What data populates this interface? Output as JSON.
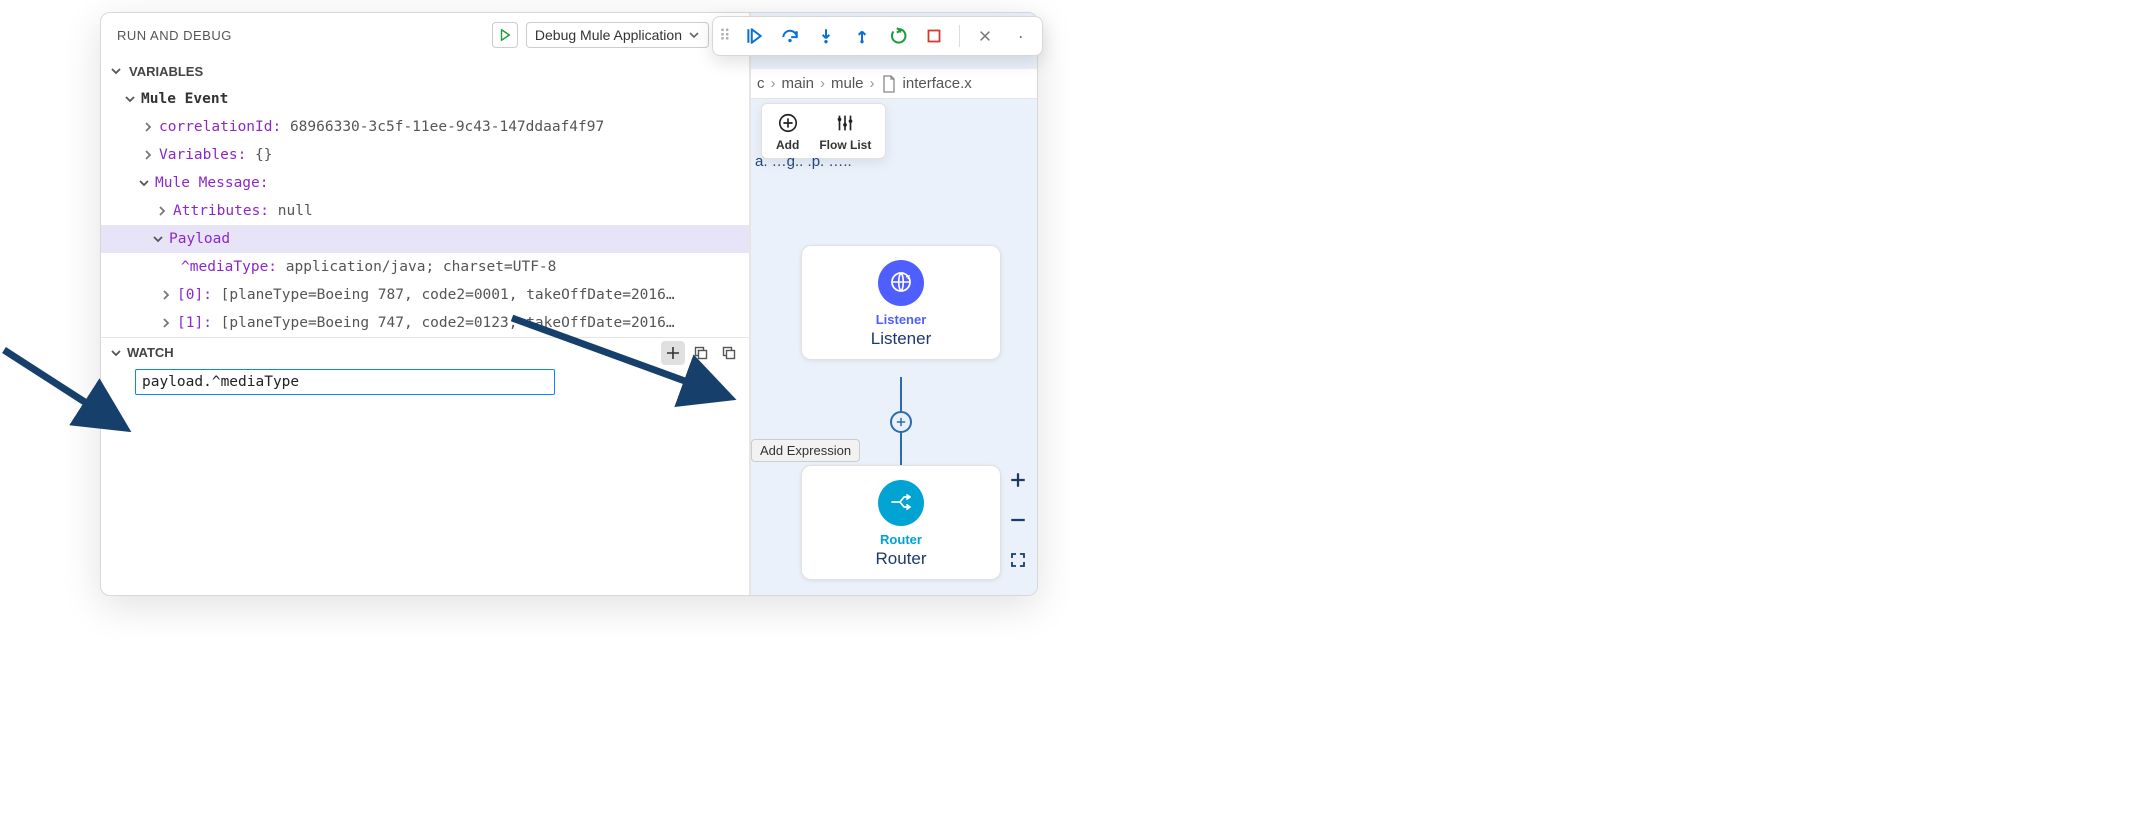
{
  "runDebug": {
    "title": "RUN AND DEBUG",
    "config": "Debug Mule Application",
    "variablesLabel": "VARIABLES",
    "watchLabel": "WATCH"
  },
  "tree": {
    "muleEvent": "Mule Event",
    "correlationKey": "correlationId:",
    "correlationVal": "68966330-3c5f-11ee-9c43-147ddaaf4f97",
    "variablesKey": "Variables:",
    "variablesVal": "{}",
    "muleMessage": "Mule Message:",
    "attributesKey": "Attributes:",
    "attributesVal": "null",
    "payload": "Payload",
    "mediaTypeKey": "^mediaType:",
    "mediaTypeVal": "application/java; charset=UTF-8",
    "r0Key": "[0]:",
    "r0Val": "[planeType=Boeing 787, code2=0001, takeOffDate=2016…",
    "r1Key": "[1]:",
    "r1Val": "[planeType=Boeing 747, code2=0123, takeOffDate=2016…"
  },
  "watch": {
    "inputValue": "payload.^mediaType",
    "tooltip": "Add Expression"
  },
  "breadcrumbs": {
    "p1": "main",
    "p2": "mule",
    "file": "interface.x"
  },
  "miniToolbar": {
    "add": "Add",
    "flowList": "Flow List"
  },
  "nodes": {
    "listenerCap": "Listener",
    "listenerLabel": "Listener",
    "routerCap": "Router",
    "routerLabel": "Router"
  }
}
